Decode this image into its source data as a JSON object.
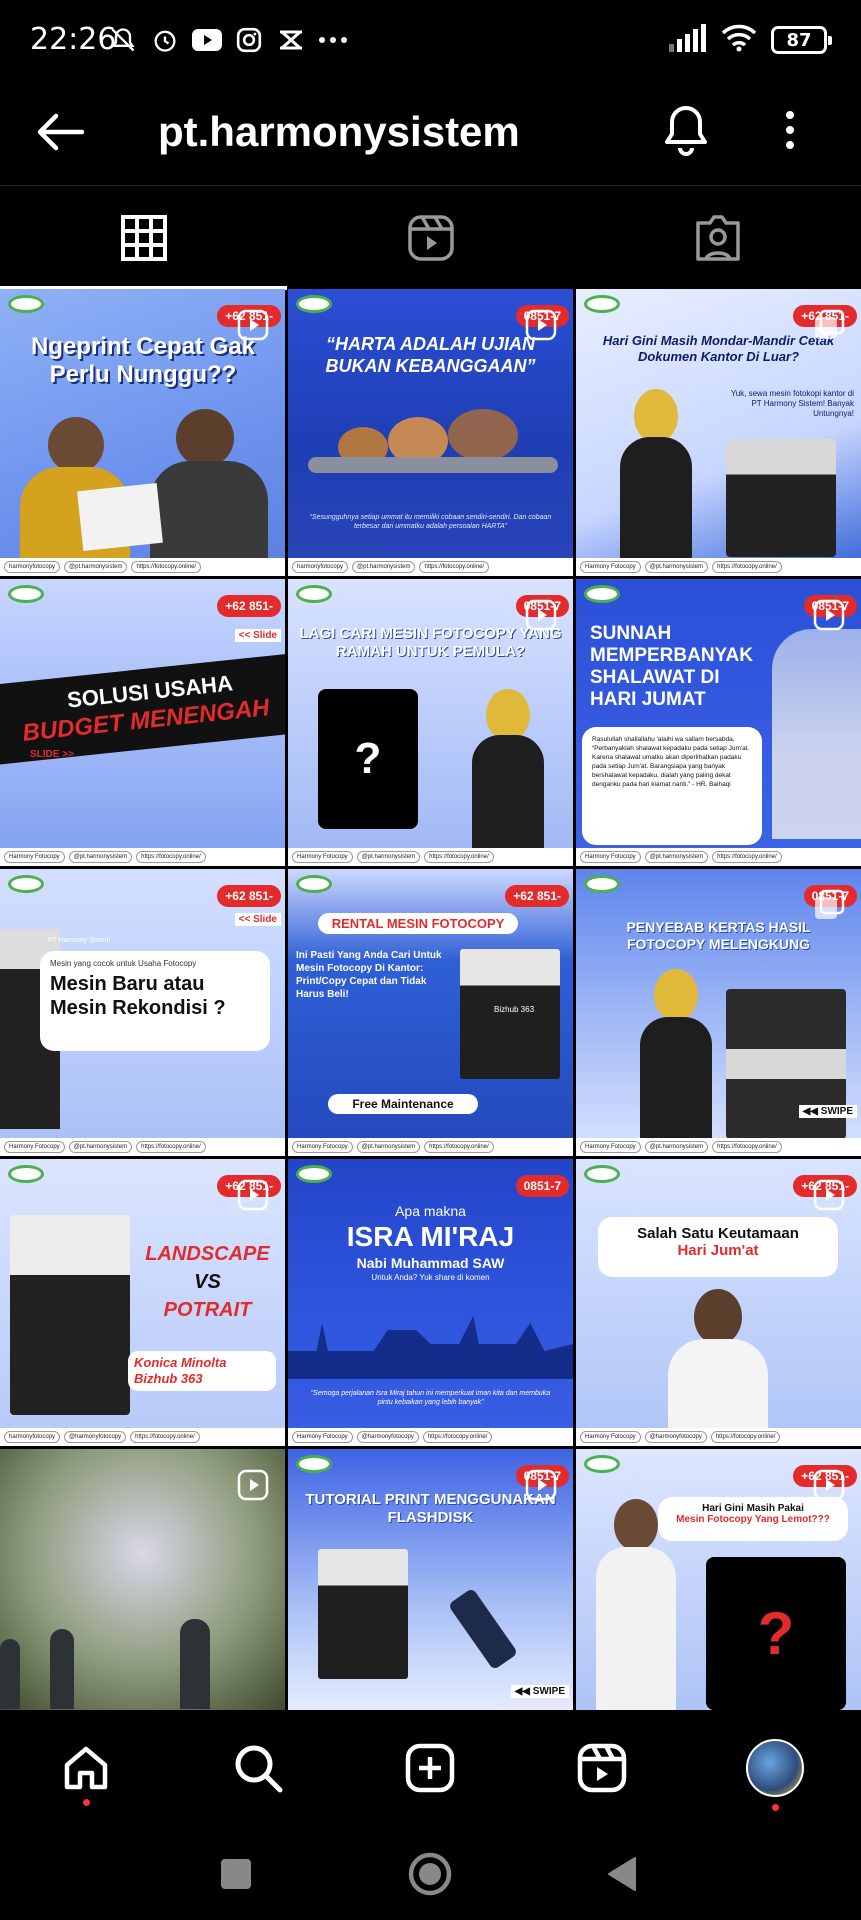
{
  "status_bar": {
    "time": "22:26",
    "battery": "87",
    "left_icons": [
      "mute-bell-icon",
      "alarm-icon",
      "youtube-icon",
      "instagram-icon",
      "app-icon",
      "more-dots-icon"
    ],
    "right_icons": [
      "signal-icon",
      "wifi-icon",
      "battery-icon"
    ]
  },
  "header": {
    "username": "pt.harmonysistem"
  },
  "tabs": [
    {
      "name": "grid-icon",
      "active": true
    },
    {
      "name": "reels-icon",
      "active": false
    },
    {
      "name": "tagged-icon",
      "active": false
    }
  ],
  "posts": {
    "p1": {
      "phone": "+62 851-",
      "headline": "Ngeprint Cepat Gak Perlu Nunggu??",
      "footer": [
        "harmonyfotocopy",
        "@pt.harmonysistem",
        "https://fotocopy.online/"
      ]
    },
    "p2": {
      "phone": "0851-7",
      "headline": "“HARTA ADALAH UJIAN BUKAN KEBANGGAAN”",
      "caption": "“Sesungguhnya setiap ummat itu memiliki cobaan sendiri-sendiri. Dan cobaan terbesar dari ummatku adalah persoalan HARTA”",
      "footer": [
        "harmonyfotocopy",
        "@pt.harmonysistem",
        "https://fotocopy.online/"
      ]
    },
    "p3": {
      "phone": "+62 851-",
      "headline": "Hari Gini Masih Mondar-Mandir Cetak Dokumen Kantor Di Luar?",
      "sub": "Yuk, sewa mesin fotokopi kantor di PT Harmony Sistem! Banyak Untungnya!",
      "footer": [
        "Harmony Fotocopy",
        "@pt.harmonysistem",
        "https://fotocopy.online/"
      ]
    },
    "p4": {
      "phone": "+62 851-",
      "slide_tag": "<< Slide",
      "line1": "SOLUSI USAHA",
      "line2": "BUDGET MENENGAH",
      "slide": "SLIDE >>",
      "footer": [
        "Harmony Fotocopy",
        "@pt.harmonysistem",
        "https://fotocopy.online/"
      ]
    },
    "p5": {
      "phone": "0851-7",
      "headline": "LAGI CARI MESIN FOTOCOPY YANG RAMAH UNTUK PEMULA?",
      "mark": "?",
      "footer": [
        "Harmony Fotocopy",
        "@pt.harmonysistem",
        "https://fotocopy.online/"
      ]
    },
    "p6": {
      "phone": "0851-7",
      "headline": "SUNNAH MEMPERBANYAK SHALAWAT DI HARI JUMAT",
      "body": "Rasulullah shallallahu 'alaihi wa sallam bersabda, “Perbanyaklah shalawat kepadaku pada setiap Jum'at. Karena shalawat umatku akan diperlihatkan padaku pada setiap Jum'at. Barangsiapa yang banyak bershalawat kepadaku, dialah yang paling dekat denganku pada hari kiamat nanti.” - HR. Baihaqi",
      "footer": [
        "Harmony Fotocopy",
        "@pt.harmonysistem",
        "https://fotocopy.online/"
      ]
    },
    "p7": {
      "phone": "+62 851-",
      "slide_tag": "<< Slide",
      "brand": "PT Harmony Sistem",
      "sub": "Mesin yang cocok untuk Usaha Fotocopy",
      "headline": "Mesin Baru atau Mesin Rekondisi ?",
      "footer": [
        "Harmony Fotocopy",
        "@pt.harmonysistem",
        "https://fotocopy.online/"
      ]
    },
    "p8": {
      "phone": "+62 851-",
      "title": "RENTAL MESIN FOTOCOPY",
      "body": "Ini Pasti Yang Anda Cari Untuk Mesin Fotocopy Di Kantor: Print/Copy Cepat dan Tidak Harus Beli!",
      "badge": "Free Maintenance",
      "model": "Bizhub 363",
      "footer": [
        "Harmony Fotocopy",
        "@pt.harmonysistem",
        "https://fotocopy.online/"
      ]
    },
    "p9": {
      "phone": "0851-7",
      "headline": "PENYEBAB KERTAS HASIL FOTOCOPY MELENGKUNG",
      "swipe": "◀◀ SWIPE",
      "footer": [
        "Harmony Fotocopy",
        "@pt.harmonysistem",
        "https://fotocopy.online/"
      ]
    },
    "p10": {
      "phone": "+62 851-",
      "line1": "LANDSCAPE",
      "line2": "VS",
      "line3": "POTRAIT",
      "model": "Konica Minolta Bizhub 363",
      "footer": [
        "harmonyfotocopy",
        "@harmonyfotocopy",
        "https://fotocopy.online/"
      ]
    },
    "p11": {
      "phone": "0851-7",
      "pre": "Apa makna",
      "headline": "ISRA MI'RAJ",
      "sub": "Nabi Muhammad SAW",
      "sub2": "Untuk Anda? Yuk share di komen",
      "caption": "“Semoga perjalanan Isra Miraj tahun ini memperkuat iman kita dan membuka pintu kebaikan yang lebih banyak”",
      "footer": [
        "Harmony Fotocopy",
        "@harmonyfotocopy",
        "https://fotocopy.online/"
      ]
    },
    "p12": {
      "phone": "+62 851-",
      "line1": "Salah Satu Keutamaan",
      "line2": "Hari Jum'at",
      "footer": [
        "Harmony Fotocopy",
        "@harmonyfotocopy",
        "https://fotocopy.online/"
      ]
    },
    "p13": {},
    "p14": {
      "phone": "0851-7",
      "headline": "TUTORIAL PRINT MENGGUNAKAN FLASHDISK",
      "swipe": "◀◀ SWIPE"
    },
    "p15": {
      "phone": "+62 851-",
      "line1": "Hari Gini Masih Pakai",
      "line2": "Mesin Fotocopy Yang Lemot???",
      "mark": "?"
    }
  },
  "bottom_nav": [
    "home-icon",
    "search-icon",
    "create-icon",
    "reels-icon",
    "profile-avatar"
  ],
  "colors": {
    "accent": "#e32b2b",
    "nav_dot": "#ff3040",
    "brand_blue": "#2f5fd6"
  }
}
